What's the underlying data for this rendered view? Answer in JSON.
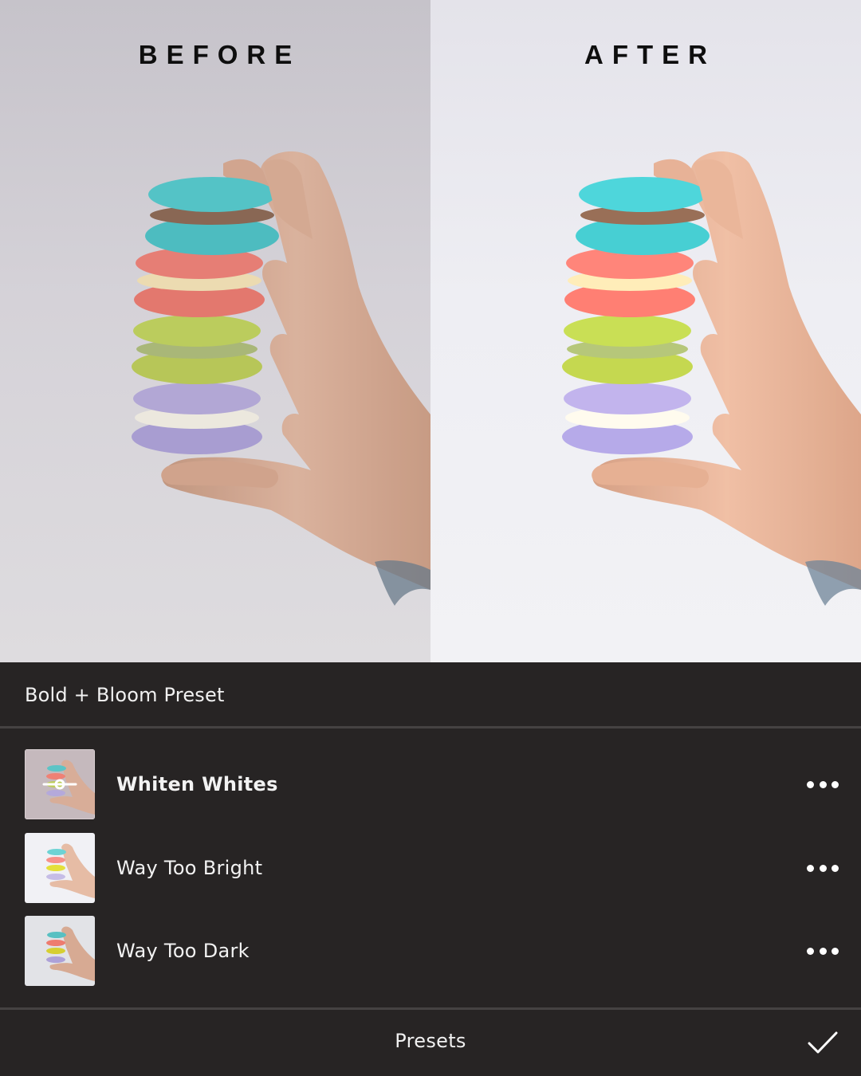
{
  "comparison": {
    "before_label": "BEFORE",
    "after_label": "AFTER"
  },
  "sheet": {
    "title": "Bold + Bloom Preset",
    "presets": [
      {
        "label": "Whiten Whites",
        "active": true
      },
      {
        "label": "Way Too Bright",
        "active": false
      },
      {
        "label": "Way Too Dark",
        "active": false
      }
    ],
    "footer_label": "Presets"
  },
  "colors": {
    "sheet_bg": "#272424",
    "divider": "#454242",
    "macaron_teal": "#4ec6c9",
    "macaron_coral": "#f07e74",
    "macaron_lime": "#b9cc4f",
    "macaron_lavender": "#b3a6dd",
    "skin": "#dcae95"
  },
  "icons": {
    "more": "more-horizontal-icon",
    "confirm": "checkmark-icon",
    "compare_slider": "compare-slider-icon"
  }
}
